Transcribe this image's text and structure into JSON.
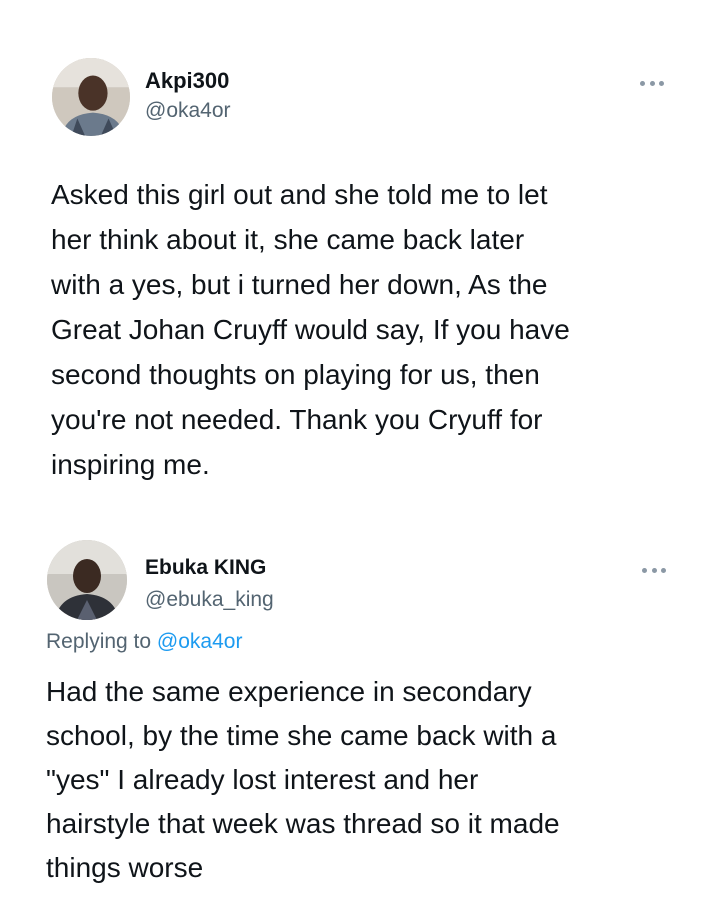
{
  "tweets": [
    {
      "author": {
        "name": "Akpi300",
        "handle": "@oka4or",
        "avatar_icon": "user-avatar-icon"
      },
      "more_icon": "more-options-icon",
      "text": "Asked this girl out and she told me to let\nher think about it, she came back later\nwith a yes, but i turned her down, As the\nGreat Johan Cruyff would say, If you have\nsecond thoughts on playing for us, then\nyou're not needed. Thank you Cryuff for\ninspiring me."
    },
    {
      "author": {
        "name": "Ebuka KING",
        "handle": "@ebuka_king",
        "avatar_icon": "user-avatar-icon"
      },
      "more_icon": "more-options-icon",
      "replying_prefix": "Replying to ",
      "replying_to": "@oka4or",
      "text": "Had the same experience in secondary\nschool, by the time she came back with a\n\"yes\" I already lost interest and her\nhairstyle that week was thread so it made\nthings worse"
    }
  ],
  "colors": {
    "text": "#0f1419",
    "secondary": "#536471",
    "link": "#1d9bf0"
  }
}
